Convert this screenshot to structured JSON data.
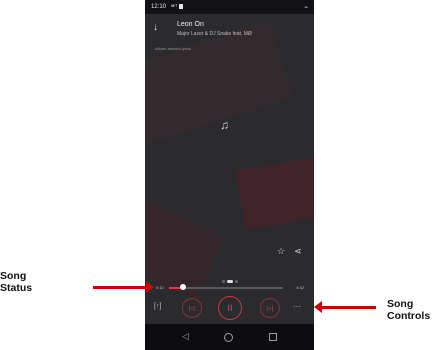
{
  "colors": {
    "accent": "#e03a4a",
    "annotation_arrow": "#cc0000",
    "background": "#2b2b2e"
  },
  "status_bar": {
    "time": "12:10",
    "net": "ᴺᴱᵀ",
    "signal_icon": "signal-icon"
  },
  "header": {
    "title": "Leon On",
    "artist": "Major Lazer & DJ Snake feat. MØ",
    "back_icon": "arrow-down-icon"
  },
  "lyrics": {
    "line": "Album artwork lyrics"
  },
  "actions": {
    "favorite_icon": "star-icon",
    "share_icon": "share-icon"
  },
  "player": {
    "elapsed": "0:10",
    "total": "4:32",
    "progress": 0.12
  },
  "controls": {
    "repeat": "[↑]",
    "previous": "|◁",
    "pause": "II",
    "next": "▷|",
    "more": "···"
  },
  "annotations": {
    "song_status": [
      "Song",
      "Status"
    ],
    "song_controls": [
      "Song",
      "Controls"
    ]
  }
}
